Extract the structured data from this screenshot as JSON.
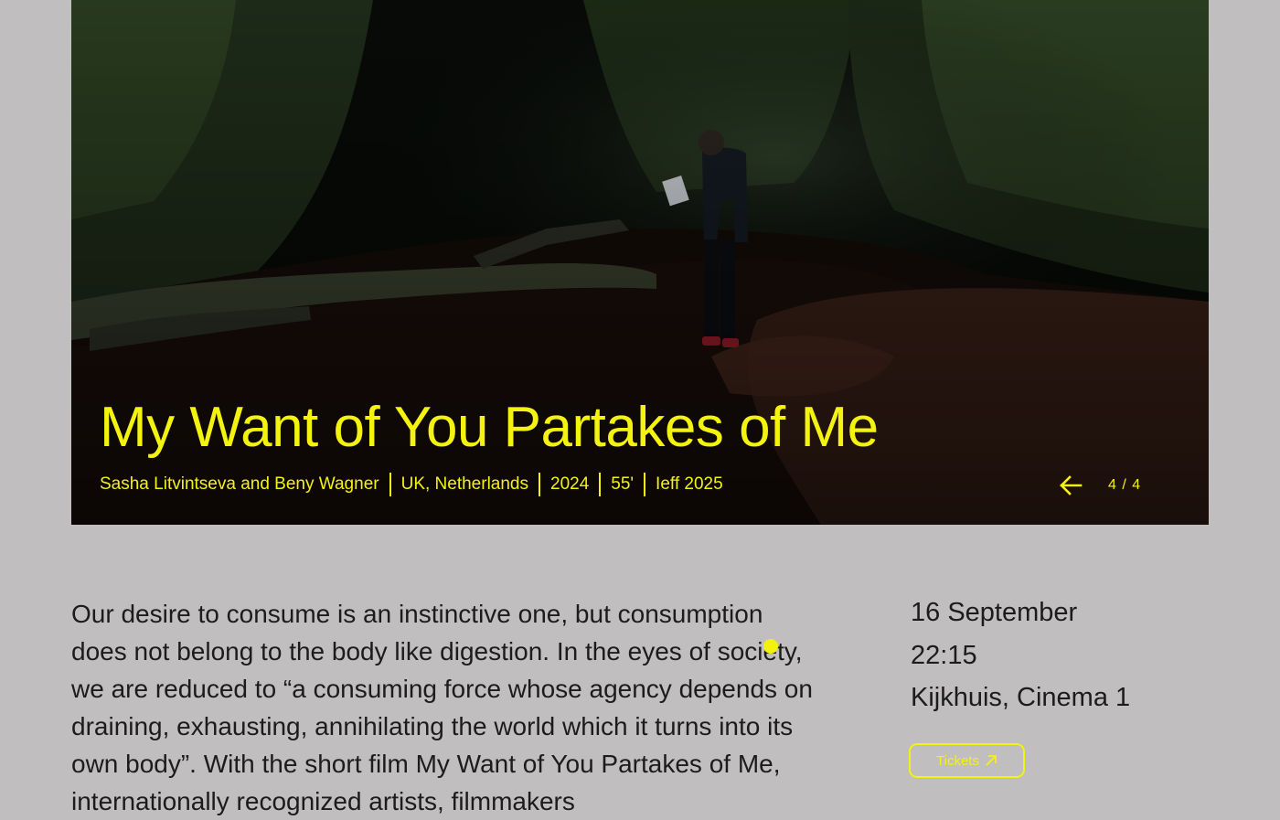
{
  "film": {
    "title": "My Want of You Partakes of Me",
    "directors": "Sasha Litvintseva and Beny Wagner",
    "countries": "UK, Netherlands",
    "year": "2024",
    "duration": "55'",
    "festival": "Ieff 2025"
  },
  "slider": {
    "counter": "4 / 4",
    "arrow_icon": "arrow-left-icon"
  },
  "description": "Our desire to consume is an instinctive one, but consumption does not belong to the body like digestion. In the eyes of society, we are reduced to “a consuming force whose agency depends on draining, exhausting, annihilating the world which it turns into its own body”. With the short film My Want of You Partakes of Me, internationally recognized artists, filmmakers",
  "screening": {
    "date": "16 September",
    "time": "22:15",
    "venue": "Kijkhuis, Cinema 1",
    "tickets_label": "Tickets",
    "tickets_icon": "arrow-up-right-icon"
  },
  "colors": {
    "accent": "#f4f20f",
    "background": "#c0bebf",
    "text": "#1c1c1c"
  }
}
